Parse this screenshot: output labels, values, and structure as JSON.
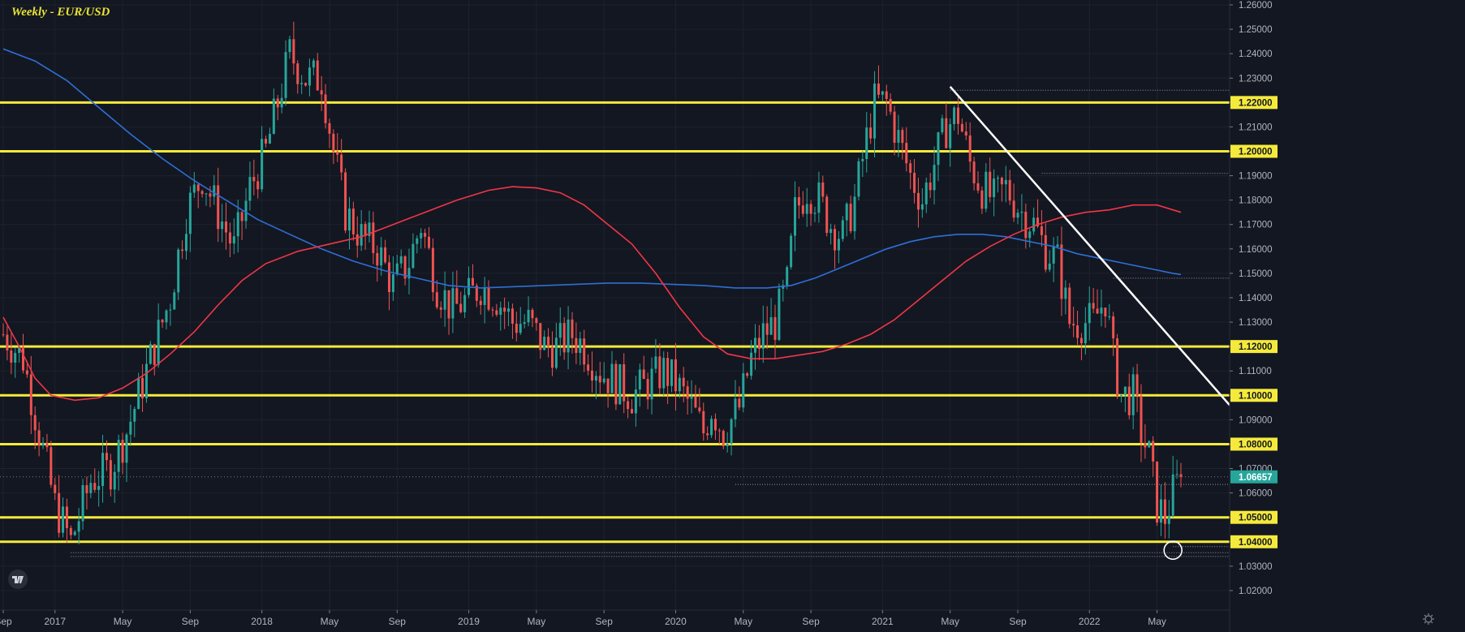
{
  "chart_data": {
    "type": "candlestick",
    "title": "Weekly - EUR/USD",
    "y_range": [
      1.012,
      1.262
    ],
    "price_ticks": [
      "1.02000",
      "1.03000",
      "1.04000",
      "1.05000",
      "1.06000",
      "1.07000",
      "1.08000",
      "1.09000",
      "1.10000",
      "1.11000",
      "1.12000",
      "1.13000",
      "1.14000",
      "1.15000",
      "1.16000",
      "1.17000",
      "1.18000",
      "1.19000",
      "1.20000",
      "1.21000",
      "1.22000",
      "1.23000",
      "1.24000",
      "1.25000",
      "1.26000"
    ],
    "time_labels": [
      "Sep",
      "2017",
      "May",
      "Sep",
      "2018",
      "May",
      "Sep",
      "2019",
      "May",
      "Sep",
      "2020",
      "May",
      "Sep",
      "2021",
      "May",
      "Sep",
      "2022",
      "May"
    ],
    "time_positions": [
      0,
      13,
      30,
      47,
      65,
      82,
      99,
      117,
      134,
      151,
      169,
      186,
      203,
      221,
      238,
      255,
      273,
      290
    ],
    "total_weeks": 310,
    "levels": [
      "1.22000",
      "1.20000",
      "1.12000",
      "1.10000",
      "1.08000",
      "1.05000",
      "1.04000"
    ],
    "current_price": "1.06657",
    "current_value": 1.0666,
    "up_color": "#26a69a",
    "down_color": "#ef5350",
    "ma_slow_color": "#2f6fd6",
    "ma_fast_color": "#f23645",
    "level_color": "#f5ea3c",
    "trendline_color": "#ffffff",
    "price_path": [
      [
        0,
        1.125
      ],
      [
        5,
        1.115
      ],
      [
        9,
        1.085
      ],
      [
        13,
        1.055
      ],
      [
        17,
        1.04
      ],
      [
        22,
        1.065
      ],
      [
        27,
        1.07
      ],
      [
        31,
        1.085
      ],
      [
        34,
        1.1
      ],
      [
        38,
        1.12
      ],
      [
        42,
        1.14
      ],
      [
        46,
        1.175
      ],
      [
        50,
        1.19
      ],
      [
        54,
        1.175
      ],
      [
        58,
        1.16
      ],
      [
        62,
        1.185
      ],
      [
        66,
        1.2
      ],
      [
        69,
        1.22
      ],
      [
        72,
        1.24
      ],
      [
        76,
        1.23
      ],
      [
        80,
        1.23
      ],
      [
        83,
        1.2
      ],
      [
        86,
        1.175
      ],
      [
        90,
        1.165
      ],
      [
        94,
        1.16
      ],
      [
        98,
        1.145
      ],
      [
        102,
        1.155
      ],
      [
        105,
        1.17
      ],
      [
        109,
        1.145
      ],
      [
        113,
        1.135
      ],
      [
        117,
        1.14
      ],
      [
        120,
        1.145
      ],
      [
        124,
        1.14
      ],
      [
        128,
        1.13
      ],
      [
        132,
        1.13
      ],
      [
        136,
        1.12
      ],
      [
        139,
        1.12
      ],
      [
        143,
        1.125
      ],
      [
        146,
        1.12
      ],
      [
        150,
        1.11
      ],
      [
        154,
        1.105
      ],
      [
        158,
        1.1
      ],
      [
        162,
        1.105
      ],
      [
        166,
        1.11
      ],
      [
        169,
        1.105
      ],
      [
        173,
        1.095
      ],
      [
        176,
        1.085
      ],
      [
        178,
        1.095
      ],
      [
        181,
        1.085
      ],
      [
        185,
        1.095
      ],
      [
        188,
        1.115
      ],
      [
        191,
        1.125
      ],
      [
        194,
        1.13
      ],
      [
        197,
        1.145
      ],
      [
        199,
        1.175
      ],
      [
        202,
        1.185
      ],
      [
        205,
        1.18
      ],
      [
        208,
        1.17
      ],
      [
        211,
        1.165
      ],
      [
        214,
        1.18
      ],
      [
        217,
        1.205
      ],
      [
        219,
        1.22
      ],
      [
        222,
        1.22
      ],
      [
        225,
        1.205
      ],
      [
        228,
        1.19
      ],
      [
        231,
        1.18
      ],
      [
        234,
        1.195
      ],
      [
        237,
        1.21
      ],
      [
        240,
        1.215
      ],
      [
        243,
        1.195
      ],
      [
        246,
        1.185
      ],
      [
        249,
        1.18
      ],
      [
        252,
        1.185
      ],
      [
        256,
        1.175
      ],
      [
        259,
        1.17
      ],
      [
        262,
        1.16
      ],
      [
        265,
        1.155
      ],
      [
        268,
        1.13
      ],
      [
        271,
        1.13
      ],
      [
        274,
        1.13
      ],
      [
        277,
        1.14
      ],
      [
        279,
        1.115
      ],
      [
        281,
        1.1
      ],
      [
        284,
        1.1
      ],
      [
        286,
        1.085
      ],
      [
        288,
        1.075
      ],
      [
        290,
        1.055
      ],
      [
        292,
        1.05
      ],
      [
        294,
        1.06
      ],
      [
        296,
        1.0666
      ]
    ],
    "ma_fast_path": [
      [
        0,
        1.132
      ],
      [
        4,
        1.12
      ],
      [
        8,
        1.107
      ],
      [
        12,
        1.1
      ],
      [
        18,
        1.098
      ],
      [
        24,
        1.099
      ],
      [
        30,
        1.103
      ],
      [
        36,
        1.109
      ],
      [
        42,
        1.117
      ],
      [
        48,
        1.126
      ],
      [
        54,
        1.137
      ],
      [
        60,
        1.147
      ],
      [
        66,
        1.154
      ],
      [
        74,
        1.159
      ],
      [
        82,
        1.162
      ],
      [
        90,
        1.165
      ],
      [
        98,
        1.17
      ],
      [
        106,
        1.175
      ],
      [
        114,
        1.18
      ],
      [
        122,
        1.184
      ],
      [
        128,
        1.1855
      ],
      [
        134,
        1.185
      ],
      [
        140,
        1.183
      ],
      [
        146,
        1.178
      ],
      [
        152,
        1.17
      ],
      [
        158,
        1.162
      ],
      [
        164,
        1.15
      ],
      [
        170,
        1.136
      ],
      [
        176,
        1.124
      ],
      [
        182,
        1.117
      ],
      [
        188,
        1.115
      ],
      [
        194,
        1.115
      ],
      [
        200,
        1.1165
      ],
      [
        206,
        1.118
      ],
      [
        212,
        1.121
      ],
      [
        218,
        1.125
      ],
      [
        224,
        1.131
      ],
      [
        230,
        1.139
      ],
      [
        236,
        1.147
      ],
      [
        242,
        1.155
      ],
      [
        248,
        1.161
      ],
      [
        254,
        1.166
      ],
      [
        260,
        1.17
      ],
      [
        266,
        1.173
      ],
      [
        272,
        1.175
      ],
      [
        278,
        1.176
      ],
      [
        284,
        1.178
      ],
      [
        290,
        1.178
      ],
      [
        294,
        1.176
      ],
      [
        296,
        1.175
      ]
    ],
    "ma_slow_path": [
      [
        0,
        1.242
      ],
      [
        8,
        1.237
      ],
      [
        16,
        1.229
      ],
      [
        24,
        1.218
      ],
      [
        32,
        1.207
      ],
      [
        40,
        1.197
      ],
      [
        48,
        1.188
      ],
      [
        56,
        1.18
      ],
      [
        64,
        1.172
      ],
      [
        72,
        1.166
      ],
      [
        80,
        1.16
      ],
      [
        88,
        1.155
      ],
      [
        96,
        1.151
      ],
      [
        104,
        1.148
      ],
      [
        112,
        1.145
      ],
      [
        120,
        1.144
      ],
      [
        128,
        1.1445
      ],
      [
        136,
        1.145
      ],
      [
        144,
        1.1455
      ],
      [
        152,
        1.146
      ],
      [
        160,
        1.146
      ],
      [
        168,
        1.1455
      ],
      [
        176,
        1.145
      ],
      [
        184,
        1.144
      ],
      [
        192,
        1.144
      ],
      [
        198,
        1.145
      ],
      [
        204,
        1.148
      ],
      [
        210,
        1.152
      ],
      [
        216,
        1.156
      ],
      [
        222,
        1.16
      ],
      [
        228,
        1.163
      ],
      [
        234,
        1.165
      ],
      [
        240,
        1.166
      ],
      [
        246,
        1.166
      ],
      [
        252,
        1.165
      ],
      [
        258,
        1.163
      ],
      [
        264,
        1.161
      ],
      [
        270,
        1.158
      ],
      [
        276,
        1.156
      ],
      [
        282,
        1.154
      ],
      [
        288,
        1.152
      ],
      [
        294,
        1.15
      ],
      [
        296,
        1.1495
      ]
    ]
  }
}
